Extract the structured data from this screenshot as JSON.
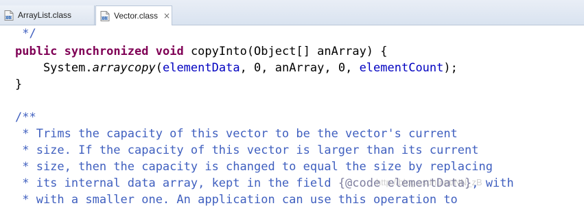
{
  "tabs": [
    {
      "label": "ArrayList.class",
      "icon": "class-file-icon",
      "active": false
    },
    {
      "label": "Vector.class",
      "icon": "class-file-icon",
      "active": true,
      "close": "×"
    }
  ],
  "code": {
    "line1": {
      "text": " */"
    },
    "line2": {
      "kw1": "public",
      "kw2": "synchronized",
      "kw3": "void",
      "rest": " copyInto(Object[] anArray) {"
    },
    "line3": {
      "prefix": "    System.",
      "static_call": "arraycopy",
      "open": "(",
      "field1": "elementData",
      "mid": ", 0, anArray, 0, ",
      "field2": "elementCount",
      "close": ");"
    },
    "line4": {
      "text": "}"
    },
    "line6": {
      "text": "/**"
    },
    "line7": {
      "text": " * Trims the capacity of this vector to be the vector's current"
    },
    "line8": {
      "text": " * size. If the capacity of this vector is larger than its current"
    },
    "line9": {
      "text": " * size, then the capacity is changed to equal the size by replacing"
    },
    "line10": {
      "pre": " * its internal data array, kept in the field ",
      "tag": "{@code elementData}",
      "post": ", with"
    },
    "line11": {
      "text": " * with a smaller one. An application can use this operation to"
    }
  },
  "watermark": "http://blog.csdn.net/NN_zB",
  "colors": {
    "keyword": "#7f0055",
    "field": "#0000c0",
    "javadoc": "#3f5fbf",
    "javadoc_tag": "#7f7f9f"
  }
}
